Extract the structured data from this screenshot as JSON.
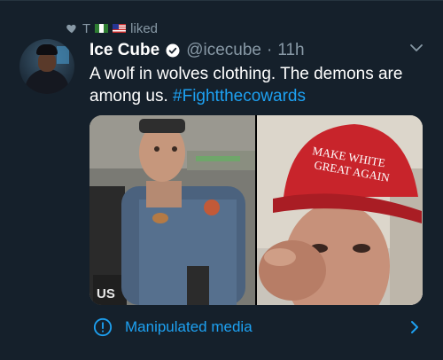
{
  "social_context": {
    "letter": "T",
    "action": "liked"
  },
  "author": {
    "display_name": "Ice Cube",
    "handle": "@icecube",
    "separator": "·",
    "timestamp": "11h"
  },
  "tweet": {
    "text": "A wolf in wolves clothing. The demons are among us.",
    "hashtag": "#Fightthecowards"
  },
  "media": {
    "right_hat_text_line1": "MAKE WHITE",
    "right_hat_text_line2": "GREAT AGAIN",
    "left_vehicle_text": "US"
  },
  "manipulated_media": {
    "label": "Manipulated media"
  },
  "colors": {
    "background": "#15202b",
    "accent": "#1da1f2",
    "muted": "#8899a6"
  },
  "icons": [
    "heart-icon",
    "verified-icon",
    "chevron-down-icon",
    "info-icon",
    "chevron-right-icon"
  ]
}
